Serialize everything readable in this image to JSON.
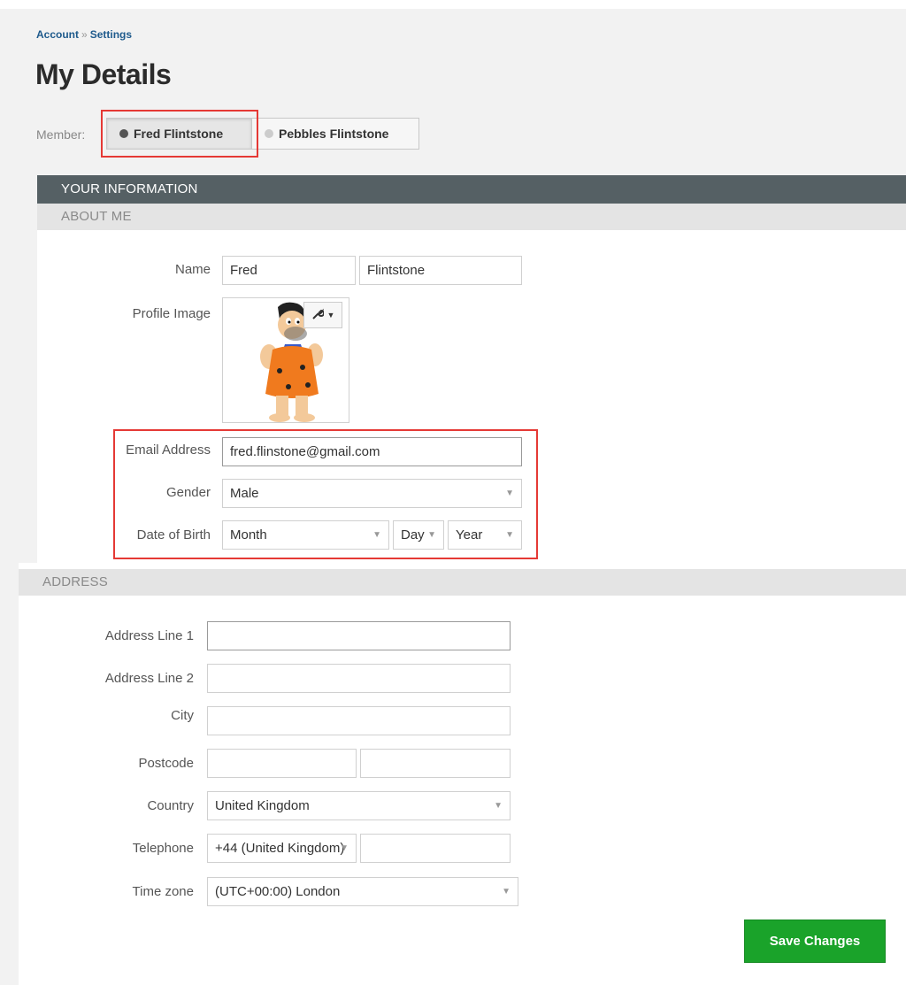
{
  "breadcrumb": {
    "account": "Account",
    "separator": "»",
    "settings": "Settings"
  },
  "page_title": "My Details",
  "member": {
    "label": "Member:",
    "tabs": [
      {
        "label": "Fred Flintstone",
        "selected": true
      },
      {
        "label": "Pebbles Flintstone",
        "selected": false
      }
    ]
  },
  "sections": {
    "your_information": "YOUR INFORMATION",
    "about_me": "ABOUT ME",
    "address": "ADDRESS"
  },
  "about": {
    "name_label": "Name",
    "first_name": "Fred",
    "last_name": "Flintstone",
    "profile_label": "Profile Image",
    "email_label": "Email Address",
    "email_value": "fred.flinstone@gmail.com",
    "gender_label": "Gender",
    "gender_value": "Male",
    "dob_label": "Date of Birth",
    "dob_month": "Month",
    "dob_day": "Day",
    "dob_year": "Year"
  },
  "address": {
    "line1_label": "Address Line 1",
    "line1_value": "",
    "line2_label": "Address Line 2",
    "line2_value": "",
    "city_label": "City",
    "city_value": "",
    "postcode_label": "Postcode",
    "postcode_value_1": "",
    "postcode_value_2": "",
    "country_label": "Country",
    "country_value": "United Kingdom",
    "telephone_label": "Telephone",
    "telephone_code": "+44 (United Kingdom)",
    "telephone_number": "",
    "timezone_label": "Time zone",
    "timezone_value": "(UTC+00:00) London"
  },
  "actions": {
    "save_label": "Save Changes"
  },
  "colors": {
    "header_bar": "#556064",
    "save_button": "#1aa32a",
    "highlight": "#e53935",
    "link": "#1e5a8c"
  }
}
